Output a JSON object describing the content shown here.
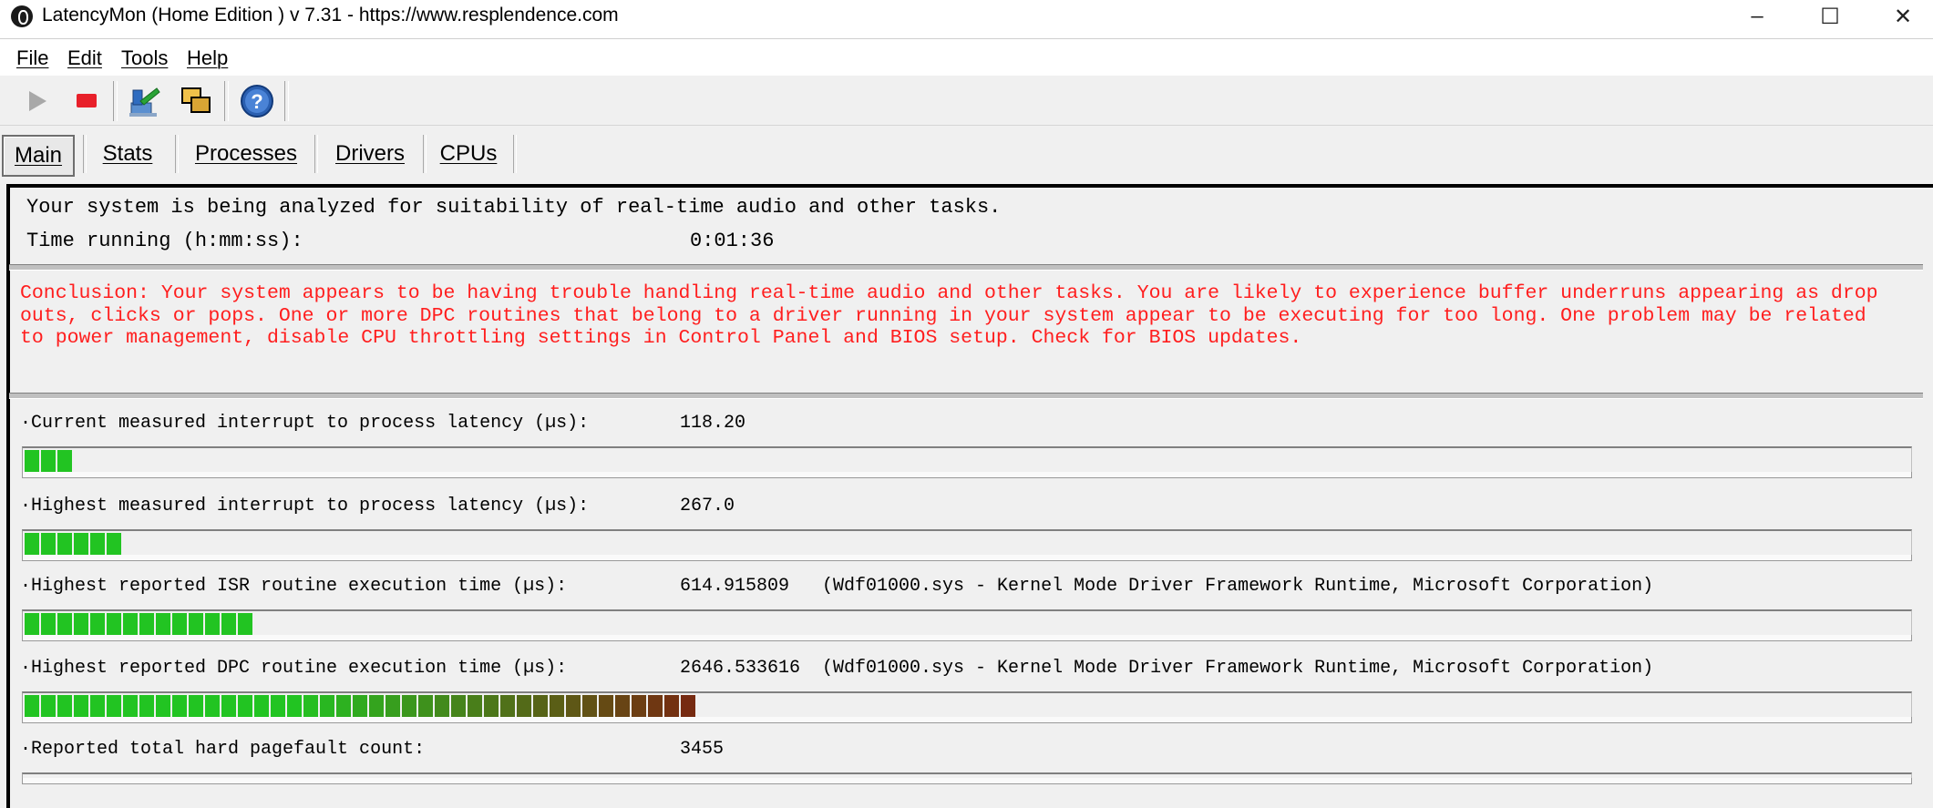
{
  "window": {
    "title": "LatencyMon  (Home Edition )  v 7.31 - https://www.resplendence.com",
    "minimize": "–",
    "maximize": "☐",
    "close": "✕"
  },
  "menu": [
    "File",
    "Edit",
    "Tools",
    "Help"
  ],
  "toolbar": {
    "buttons": [
      "play-icon",
      "stop-icon",
      "report-icon",
      "windows-icon",
      "help-icon"
    ]
  },
  "tabs": [
    "Main",
    "Stats",
    "Processes",
    "Drivers",
    "CPUs"
  ],
  "main": {
    "status_line": "Your system is being analyzed for suitability of real-time audio and other tasks.",
    "time_label": "Time running (h:mm:ss):",
    "time_value": "0:01:36",
    "conclusion": "Conclusion: Your system appears to be having trouble handling real-time audio and other tasks. You are likely to experience buffer underruns appearing as drop outs, clicks or pops. One or more DPC routines that belong to a driver running in your system appear to be executing for too long. One problem may be related to power management, disable CPU throttling settings in Control Panel and BIOS setup. Check for BIOS updates.",
    "conclusion_color": "#ff1e1e",
    "metrics": [
      {
        "label": "·Current measured interrupt to process latency (µs):",
        "value": "118.20",
        "segments": 3
      },
      {
        "label": "·Highest measured interrupt to process latency (µs):",
        "value": "267.0",
        "segments": 6
      },
      {
        "label": "·Highest reported ISR routine execution time (µs):",
        "value": "614.915809   (Wdf01000.sys - Kernel Mode Driver Framework Runtime, Microsoft Corporation)",
        "segments": 14
      },
      {
        "label": "·Highest reported DPC routine execution time (µs):",
        "value": "2646.533616  (Wdf01000.sys - Kernel Mode Driver Framework Runtime, Microsoft Corporation)",
        "segments": 41
      },
      {
        "label": "·Reported total hard pagefault count:",
        "value": "3455",
        "segments": 0
      }
    ]
  },
  "colors": {
    "bar_green": "#22c422",
    "bar_red_end": "#7a2410"
  }
}
